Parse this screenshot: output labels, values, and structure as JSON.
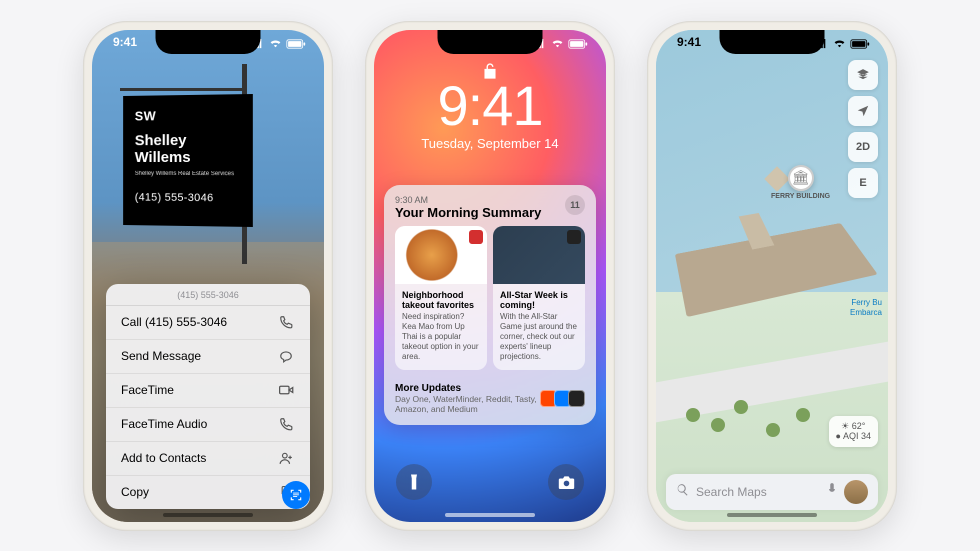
{
  "status": {
    "time": "9:41"
  },
  "phone1": {
    "sign": {
      "logo": "SW",
      "name": "Shelley Willems",
      "sub": "Shelley Willems\nReal Estate Services",
      "phone": "(415) 555-3046"
    },
    "menu": {
      "header": "(415) 555-3046",
      "items": [
        {
          "label": "Call (415) 555-3046",
          "icon": "phone"
        },
        {
          "label": "Send Message",
          "icon": "message"
        },
        {
          "label": "FaceTime",
          "icon": "video"
        },
        {
          "label": "FaceTime Audio",
          "icon": "phone"
        },
        {
          "label": "Add to Contacts",
          "icon": "contact"
        },
        {
          "label": "Copy",
          "icon": "copy"
        }
      ]
    }
  },
  "phone2": {
    "clock": {
      "time": "9:41",
      "date": "Tuesday, September 14"
    },
    "notif": {
      "time": "9:30 AM",
      "title": "Your Morning Summary",
      "count": "11",
      "cards": [
        {
          "title": "Neighborhood takeout favorites",
          "text": "Need inspiration? Kea Mao from Up Thai is a popular takeout option in your area."
        },
        {
          "title": "All-Star Week is coming!",
          "text": "With the All-Star Game just around the corner, check out our experts' lineup projections."
        }
      ],
      "more": {
        "title": "More Updates",
        "text": "Day One, WaterMinder, Reddit, Tasty, Amazon, and Medium"
      }
    }
  },
  "phone3": {
    "controls": {
      "c2d": "2D",
      "compass": "E"
    },
    "poi": {
      "label": "FERRY\nBUILDING"
    },
    "label1": "Ferry Bu",
    "label2": "Embarca",
    "weather": {
      "temp": "62°",
      "aqi": "AQI 34"
    },
    "search": {
      "placeholder": "Search Maps"
    }
  }
}
